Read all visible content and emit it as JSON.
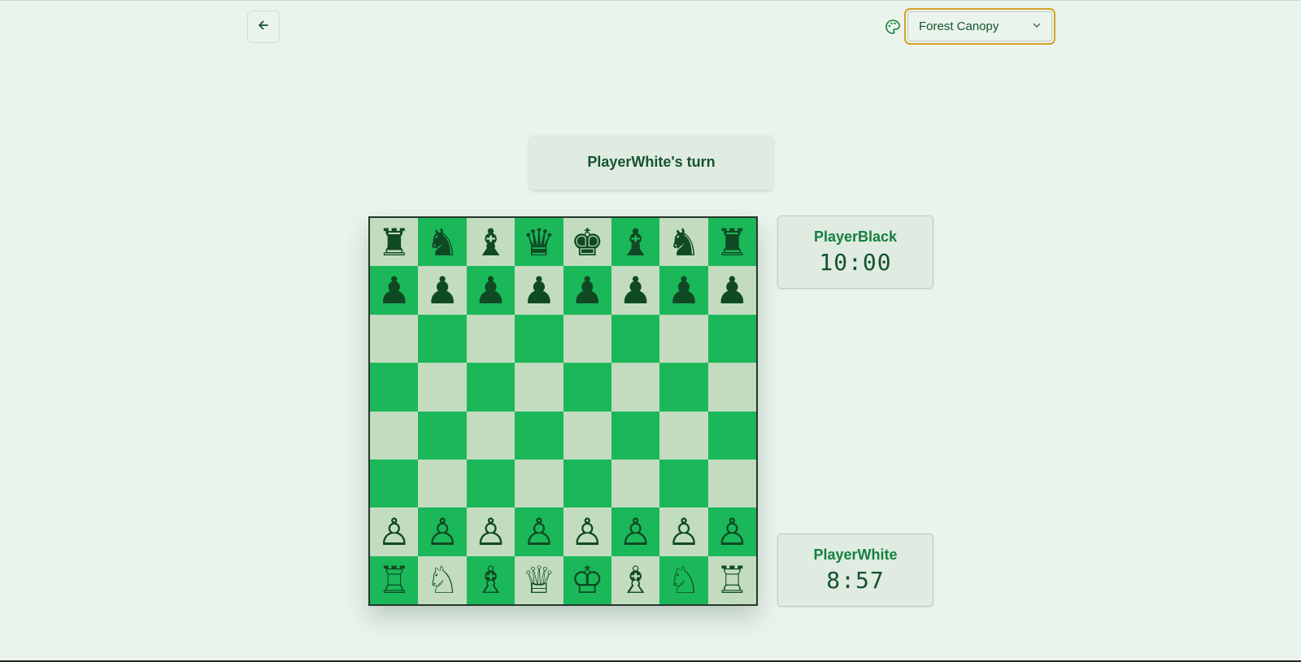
{
  "header": {
    "back_icon": "arrow-left-icon",
    "palette_icon": "palette-icon",
    "theme": {
      "selected": "Forest Canopy",
      "icon": "chevron-down-icon"
    }
  },
  "status": {
    "turn_text": "PlayerWhite's turn"
  },
  "players": {
    "black": {
      "name": "PlayerBlack",
      "time": "10:00"
    },
    "white": {
      "name": "PlayerWhite",
      "time": "8:57"
    }
  },
  "board": {
    "colors": {
      "light": "#c3dcc0",
      "dark": "#1bb85a",
      "piece": "#0f4a24"
    },
    "rows": [
      [
        "♜",
        "♞",
        "♝",
        "♛",
        "♚",
        "♝",
        "♞",
        "♜"
      ],
      [
        "♟",
        "♟",
        "♟",
        "♟",
        "♟",
        "♟",
        "♟",
        "♟"
      ],
      [
        "",
        "",
        "",
        "",
        "",
        "",
        "",
        ""
      ],
      [
        "",
        "",
        "",
        "",
        "",
        "",
        "",
        ""
      ],
      [
        "",
        "",
        "",
        "",
        "",
        "",
        "",
        ""
      ],
      [
        "",
        "",
        "",
        "",
        "",
        "",
        "",
        ""
      ],
      [
        "♙",
        "♙",
        "♙",
        "♙",
        "♙",
        "♙",
        "♙",
        "♙"
      ],
      [
        "♖",
        "♘",
        "♗",
        "♕",
        "♔",
        "♗",
        "♘",
        "♖"
      ]
    ]
  }
}
